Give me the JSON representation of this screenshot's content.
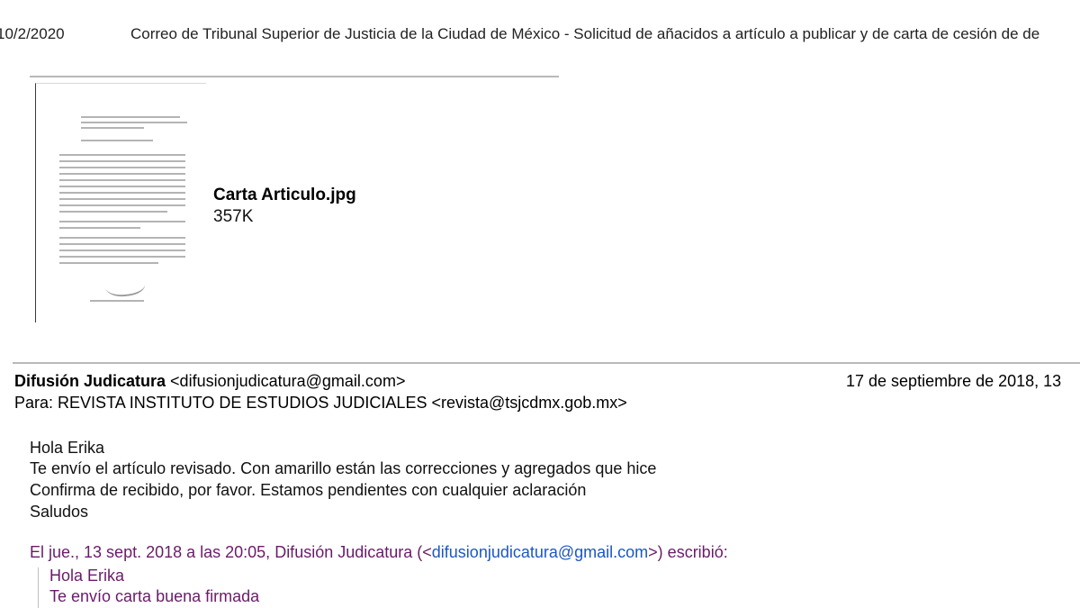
{
  "print_header": {
    "date": "10/2/2020",
    "title": "Correo de Tribunal Superior de Justicia de la Ciudad de México - Solicitud de añacidos a artículo a publicar y de carta de cesión de de"
  },
  "attachment": {
    "filename": "Carta Articulo.jpg",
    "size": "357K"
  },
  "message": {
    "sender_name": "Difusión Judicatura",
    "sender_email": "<difusionjudicatura@gmail.com>",
    "date": "17 de septiembre de 2018, 13",
    "to_label": "Para:",
    "to_value": "REVISTA INSTITUTO DE ESTUDIOS JUDICIALES <revista@tsjcdmx.gob.mx>",
    "body": [
      "Hola Erika",
      "Te envío el artículo revisado. Con amarillo están las correcciones y agregados que hice",
      "Confirma de recibido, por favor. Estamos pendientes con cualquier aclaración",
      "Saludos"
    ]
  },
  "quoted": {
    "header_prefix": "El jue., 13 sept. 2018 a las 20:05, Difusión Judicatura (<",
    "header_email": "difusionjudicatura@gmail.com",
    "header_suffix": ">) escribió:",
    "lines": [
      "Hola Erika",
      "Te envío carta buena firmada"
    ]
  }
}
